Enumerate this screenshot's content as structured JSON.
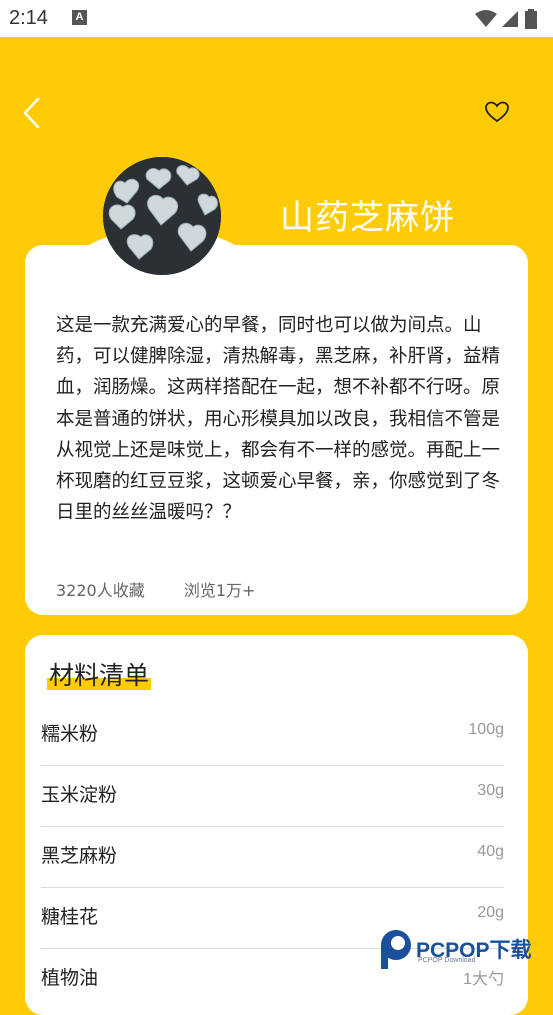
{
  "status_bar": {
    "time": "2:14",
    "notification_icon": "a-letter-icon",
    "wifi_icon": "wifi-icon",
    "signal_icon": "signal-icon",
    "battery_icon": "battery-icon"
  },
  "header": {
    "back_icon": "chevron-left-icon",
    "favorite_icon": "heart-outline-icon"
  },
  "recipe": {
    "title": "山药芝麻饼",
    "description": "这是一款充满爱心的早餐，同时也可以做为间点。山药，可以健脾除湿，清热解毒，黑芝麻，补肝肾，益精血，润肠燥。这两样搭配在一起，想不补都不行呀。原本是普通的饼状，用心形模具加以改良，我相信不管是从视觉上还是味觉上，都会有不一样的感觉。再配上一杯现磨的红豆豆浆，这顿爱心早餐，亲，你感觉到了冬日里的丝丝温暖吗？？",
    "favorites": "3220人收藏",
    "views": "浏览1万+"
  },
  "ingredients": {
    "title": "材料清单",
    "items": [
      {
        "name": "糯米粉",
        "amount": "100g"
      },
      {
        "name": "玉米淀粉",
        "amount": "30g"
      },
      {
        "name": "黑芝麻粉",
        "amount": "40g"
      },
      {
        "name": "糖桂花",
        "amount": "20g"
      },
      {
        "name": "植物油",
        "amount": "1大勺"
      }
    ]
  },
  "watermark": {
    "brand": "PCPOP下载",
    "sub": "PCPOP Download"
  },
  "colors": {
    "background": "#FFCB05",
    "card": "#FFFFFF",
    "watermark": "#1a4f9c"
  }
}
